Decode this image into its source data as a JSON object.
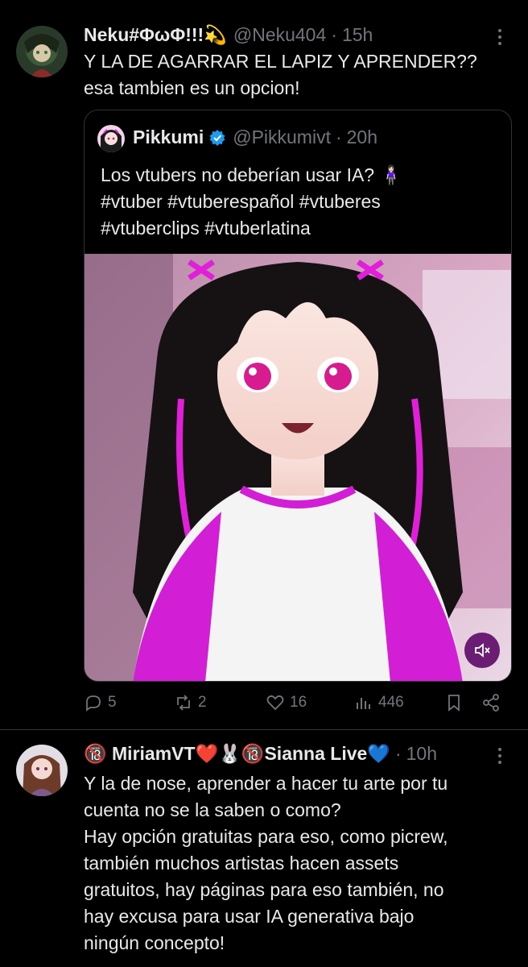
{
  "tweet1": {
    "display_name": "Neku#ΦωΦ!!!💫",
    "handle": "@Neku404",
    "dot": "·",
    "time": "15h",
    "text": "Y LA DE AGARRAR EL LAPIZ Y APRENDER??\nesa tambien es un opcion!",
    "quote": {
      "display_name": "Pikkumi",
      "handle": "@Pikkumivt",
      "dot": "·",
      "time": "20h",
      "text": "Los vtubers no deberían usar IA? 🧍🏻‍♀️\n#vtuber #vtuberespañol #vtuberes\n#vtuberclips #vtuberlatina"
    },
    "actions": {
      "replies": "5",
      "retweets": "2",
      "likes": "16",
      "views": "446"
    }
  },
  "tweet2": {
    "display_name": "🔞 MiriamVT❤️🐰🔞Sianna Live💙",
    "dot": "·",
    "time": "10h",
    "text": "Y la de nose, aprender a hacer tu arte por tu\ncuenta no se la saben o como?\nHay opción gratuitas para eso, como picrew,\ntambién muchos artistas hacen assets\ngratuitos, hay páginas para eso también, no\nhay excusa para usar IA generativa bajo\nningún concepto!"
  },
  "icons": {
    "more": "more-icon",
    "verified": "verified-badge-icon",
    "mute": "speaker-muted-icon",
    "reply": "reply-icon",
    "retweet": "retweet-icon",
    "like": "heart-icon",
    "views": "views-icon",
    "bookmark": "bookmark-icon",
    "share": "share-icon"
  },
  "colors": {
    "background": "#000000",
    "text": "#e7e9ea",
    "muted": "#71767b",
    "border": "#2f3336",
    "verified": "#1d9bf0",
    "accent_pink": "#e020d8"
  }
}
